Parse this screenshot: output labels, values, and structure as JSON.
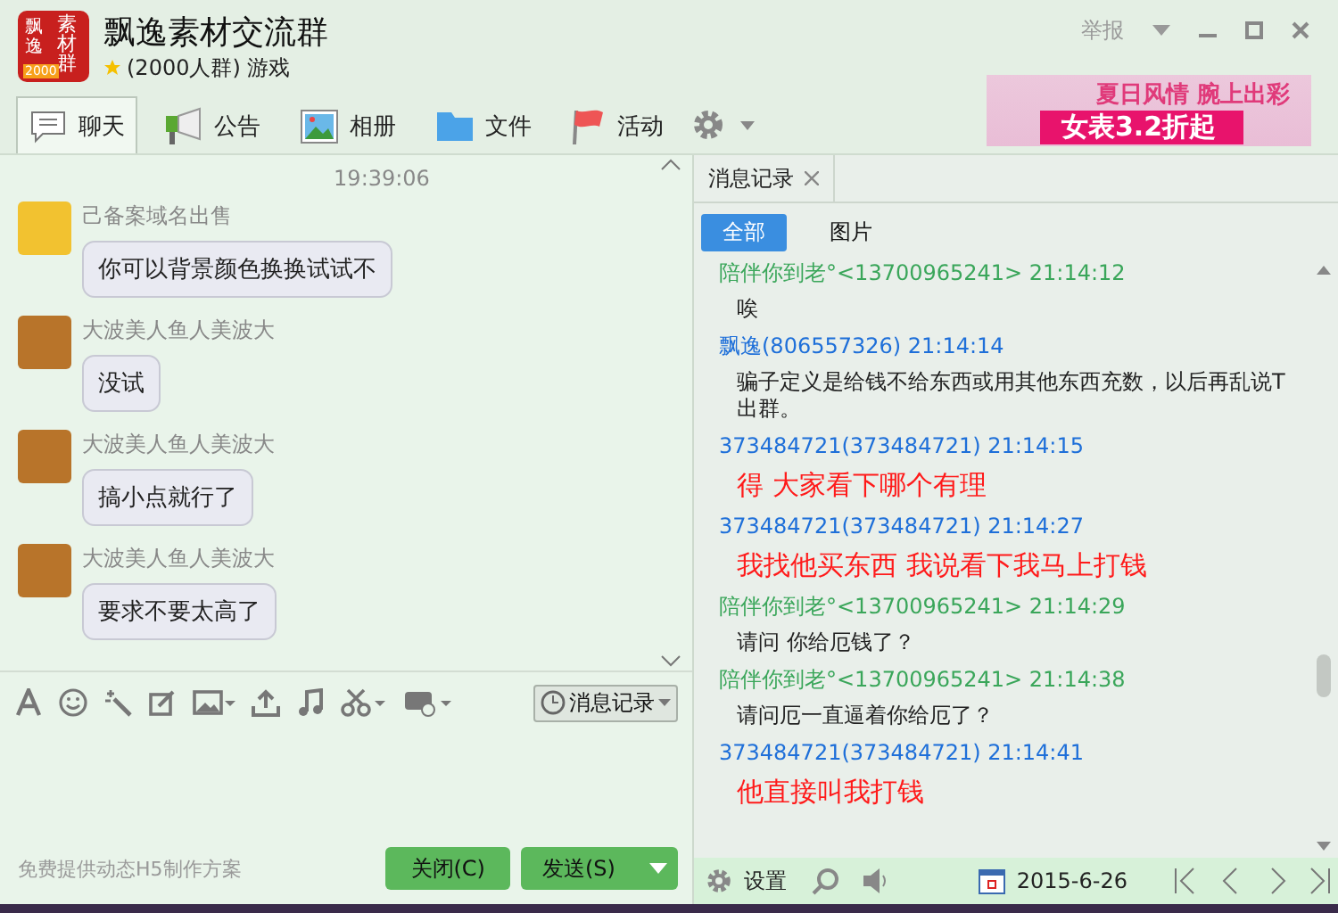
{
  "window": {
    "title": "飘逸素材交流群",
    "logo_text": "素材群",
    "logo_side": "飘逸",
    "logo_badge": "2000",
    "group_info": "(2000人群) 游戏",
    "report": "举报"
  },
  "tabs": [
    {
      "label": "聊天",
      "kind": "chat",
      "selected": true
    },
    {
      "label": "公告",
      "kind": "notice",
      "selected": false
    },
    {
      "label": "相册",
      "kind": "album",
      "selected": false
    },
    {
      "label": "文件",
      "kind": "files",
      "selected": false
    },
    {
      "label": "活动",
      "kind": "event",
      "selected": false
    }
  ],
  "ad": {
    "line1": "夏日风情 腕上出彩",
    "line2": "女表3.2折起"
  },
  "chat": {
    "timestamp": "19:39:06",
    "messages": [
      {
        "sender": "己备案域名出售",
        "text": "你可以背景颜色换换试试不",
        "color": "#f2c230"
      },
      {
        "sender": "大波美人鱼人美波大",
        "text": "没试",
        "color": "#b8742a"
      },
      {
        "sender": "大波美人鱼人美波大",
        "text": "搞小点就行了",
        "color": "#b8742a"
      },
      {
        "sender": "大波美人鱼人美波大",
        "text": "要求不要太高了",
        "color": "#b8742a"
      }
    ]
  },
  "composer": {
    "history_button": "消息记录",
    "footer_text": "免费提供动态H5制作方案",
    "close_button": "关闭(C)",
    "send_button": "发送(S)"
  },
  "history": {
    "tab_title": "消息记录",
    "filters": [
      {
        "label": "全部",
        "selected": true
      },
      {
        "label": "图片",
        "selected": false
      }
    ],
    "entries": [
      {
        "kind": "header",
        "text": "陪伴你到老°<13700965241> 21:14:12",
        "color": "#3aa65a"
      },
      {
        "kind": "message",
        "text": "唉",
        "color": "#222222"
      },
      {
        "kind": "header",
        "text": "飘逸(806557326) 21:14:14",
        "color": "#1e6fd9"
      },
      {
        "kind": "message",
        "text": "骗子定义是给钱不给东西或用其他东西充数，以后再乱说T出群。",
        "color": "#222222"
      },
      {
        "kind": "header",
        "text": "373484721(373484721) 21:14:15",
        "color": "#1e6fd9"
      },
      {
        "kind": "big",
        "text": "得  大家看下哪个有理",
        "color": "#ff1a1a"
      },
      {
        "kind": "header",
        "text": "373484721(373484721) 21:14:27",
        "color": "#1e6fd9"
      },
      {
        "kind": "big",
        "text": "我找他买东西 我说看下我马上打钱",
        "color": "#ff1a1a"
      },
      {
        "kind": "header",
        "text": "陪伴你到老°<13700965241> 21:14:29",
        "color": "#3aa65a"
      },
      {
        "kind": "message",
        "text": "请问 你给厄钱了？",
        "color": "#222222"
      },
      {
        "kind": "header",
        "text": "陪伴你到老°<13700965241> 21:14:38",
        "color": "#3aa65a"
      },
      {
        "kind": "message",
        "text": "请问厄一直逼着你给厄了？",
        "color": "#222222"
      },
      {
        "kind": "header",
        "text": "373484721(373484721) 21:14:41",
        "color": "#1e6fd9"
      },
      {
        "kind": "big",
        "text": "他直接叫我打钱",
        "color": "#ff1a1a"
      }
    ],
    "settings": "设置",
    "date": "2015-6-26"
  }
}
